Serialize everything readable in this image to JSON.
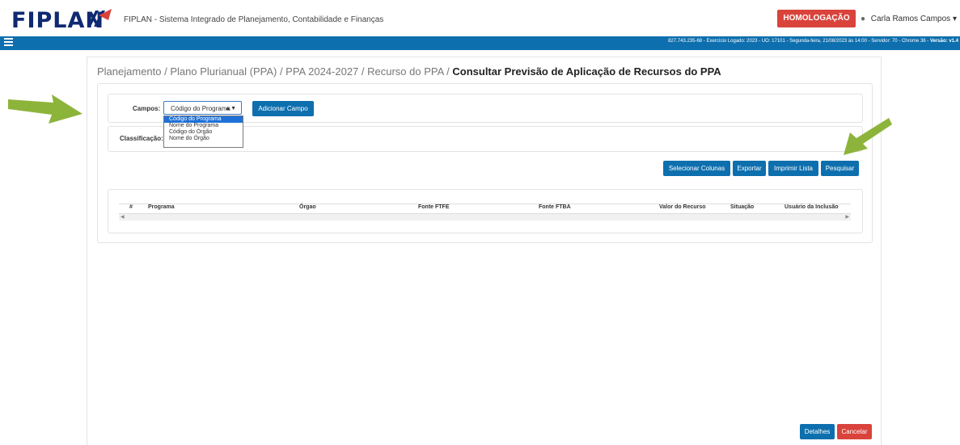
{
  "header": {
    "logo": "FIPLAN",
    "app_title": "FIPLAN - Sistema Integrado de Planejamento, Contabilidade e Finanças",
    "env_badge": "HOMOLOGAÇÃO",
    "user_name": "Carla Ramos Campos",
    "status_text": "827.743.235-68 - Exercício Logado: 2023 - UO: 17101 - Segunda-feira, 21/08/2023 às 14:00 - Servidor: 70 - Chrome 36 - ",
    "version_label": "Versão: v1.4"
  },
  "breadcrumb": {
    "path": "Planejamento / Plano Plurianual (PPA) / PPA 2024-2027 / Recurso do PPA / ",
    "current": "Consultar Previsão de Aplicação de Recursos do PPA"
  },
  "filters": {
    "campos_label": "Campos:",
    "selected": "Código do Programa",
    "add_field_button": "Adicionar Campo",
    "classificacao_label": "Classificação:",
    "options": [
      "Código do Programa",
      "Nome do Programa",
      "Código do Órgão",
      "Nome do Órgão"
    ]
  },
  "actions": {
    "select_columns": "Selecionar Colunas",
    "export": "Exportar",
    "print_list": "Imprimir Lista",
    "search": "Pesquisar"
  },
  "table": {
    "columns": [
      "#",
      "Programa",
      "Órgao",
      "Fonte FTFE",
      "Fonte FTBA",
      "Valor do Recurso",
      "Situação",
      "Usuário da Inclusão"
    ]
  },
  "footer": {
    "details": "Detalhes",
    "cancel": "Cancelar"
  },
  "colors": {
    "primary": "#0d6fae",
    "danger": "#d9433b",
    "arrow": "#8db43a"
  }
}
